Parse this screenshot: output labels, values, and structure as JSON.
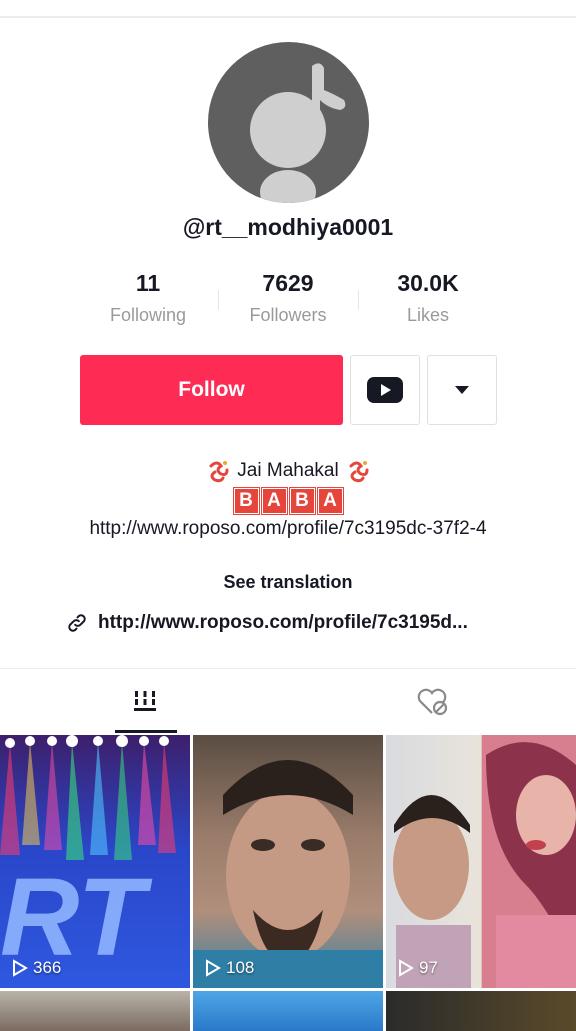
{
  "profile": {
    "username": "@rt__modhiya0001"
  },
  "stats": [
    {
      "value": "11",
      "label": "Following"
    },
    {
      "value": "7629",
      "label": "Followers"
    },
    {
      "value": "30.0K",
      "label": "Likes"
    }
  ],
  "actions": {
    "follow_label": "Follow",
    "youtube_icon": "youtube-icon",
    "more_icon": "triangle-down-icon"
  },
  "bio": {
    "line1": "Jai Mahakal",
    "baba_letters": [
      "B",
      "A",
      "B",
      "A"
    ],
    "url": "http://www.roposo.com/profile/7c3195dc-37f2-4",
    "see_translation": "See translation"
  },
  "link": {
    "text": "http://www.roposo.com/profile/7c3195d..."
  },
  "tabs": [
    {
      "icon": "grid-icon",
      "active": true
    },
    {
      "icon": "liked-hidden-icon",
      "active": false
    }
  ],
  "videos": [
    {
      "views": "366",
      "overlay_text": "RT"
    },
    {
      "views": "108"
    },
    {
      "views": "97"
    }
  ],
  "colors": {
    "accent": "#fe2c55",
    "text": "#161823",
    "muted": "#9a9a9a"
  }
}
